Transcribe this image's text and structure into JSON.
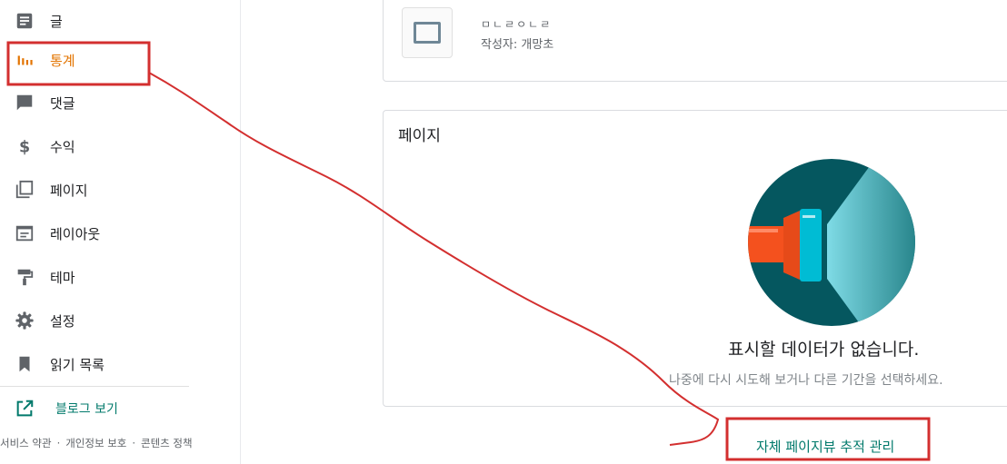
{
  "sidebar": {
    "items": [
      {
        "label": "글",
        "icon": "post-icon"
      },
      {
        "label": "통계",
        "icon": "stats-icon",
        "active": true
      },
      {
        "label": "댓글",
        "icon": "comment-icon"
      },
      {
        "label": "수익",
        "icon": "dollar-icon"
      },
      {
        "label": "페이지",
        "icon": "pages-icon"
      },
      {
        "label": "레이아웃",
        "icon": "layout-icon"
      },
      {
        "label": "테마",
        "icon": "paint-roller-icon"
      },
      {
        "label": "설정",
        "icon": "gear-icon"
      },
      {
        "label": "읽기 목록",
        "icon": "bookmark-icon"
      }
    ],
    "view_blog": {
      "label": "블로그 보기",
      "icon": "open-external-icon"
    },
    "footer": {
      "terms": "서비스 약관",
      "privacy": "개인정보 보호",
      "content_policy": "콘텐츠 정책",
      "separator": "·"
    }
  },
  "post": {
    "title": "ㅁㄴㄹㅇㄴㄹ",
    "author": "작성자: 개망초"
  },
  "pages_card": {
    "title": "페이지",
    "empty_title": "표시할 데이터가 없습니다.",
    "empty_subtitle": "나중에 다시 시도해 보거나 다른 기간을 선택하세요."
  },
  "manage_link": "자체 페이지뷰 추적 관리",
  "colors": {
    "active": "#e37400",
    "link": "#00796b",
    "annotation": "#d32f2f",
    "illustration_dark": "#05575f",
    "illustration_orange": "#f4511e",
    "illustration_cyan": "#00bcd4"
  }
}
